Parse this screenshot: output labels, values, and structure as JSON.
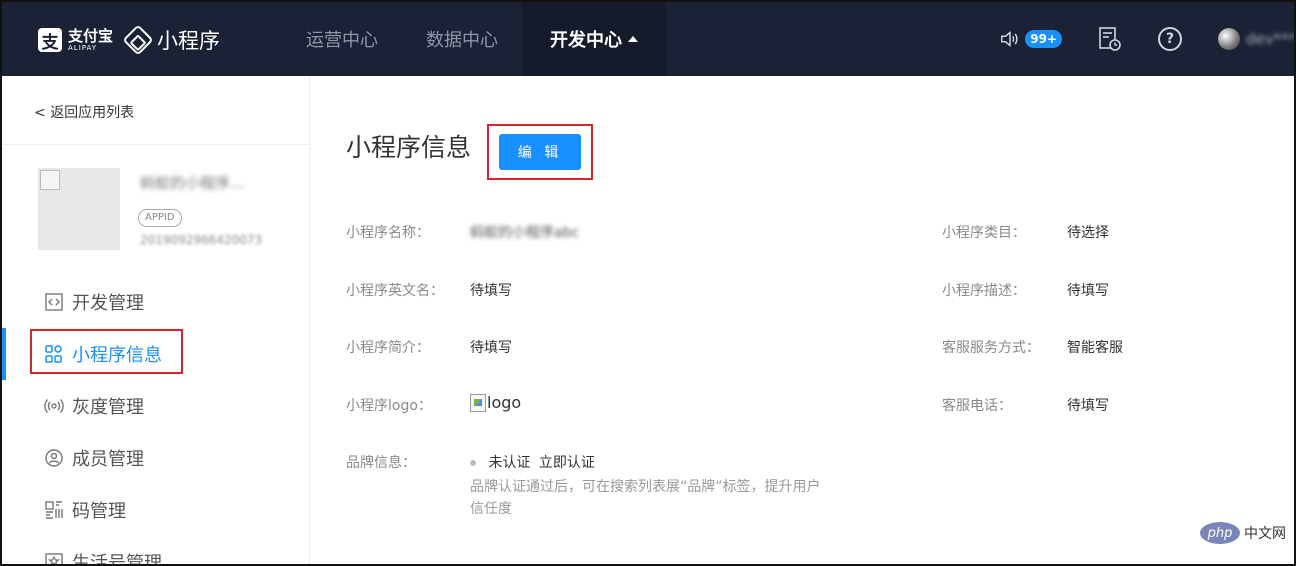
{
  "header": {
    "alipay_cn": "支付宝",
    "alipay_en": "ALIPAY",
    "product": "小程序",
    "nav": [
      {
        "label": "运营中心"
      },
      {
        "label": "数据中心"
      },
      {
        "label": "开发中心"
      }
    ],
    "notification_badge": "99+",
    "username": "dev***",
    "help_symbol": "?"
  },
  "sidebar": {
    "back": "返回应用列表",
    "app_name": "蚂蚁的小程序...",
    "appid_tag": "APPID",
    "appid": "2019092966420073",
    "items": [
      {
        "label": "开发管理",
        "icon": "code-icon"
      },
      {
        "label": "小程序信息",
        "icon": "grid-icon",
        "active": true
      },
      {
        "label": "灰度管理",
        "icon": "broadcast-icon"
      },
      {
        "label": "成员管理",
        "icon": "user-icon"
      },
      {
        "label": "码管理",
        "icon": "qrcode-icon"
      },
      {
        "label": "生活号管理",
        "icon": "life-icon"
      }
    ]
  },
  "main": {
    "title": "小程序信息",
    "edit_button": "编 辑",
    "fields": {
      "name_label": "小程序名称：",
      "name_value": "蚂蚁的小程序abc",
      "category_label": "小程序类目：",
      "category_value": "待选择",
      "en_name_label": "小程序英文名：",
      "en_name_value": "待填写",
      "desc_label": "小程序描述：",
      "desc_value": "待填写",
      "intro_label": "小程序简介：",
      "intro_value": "待填写",
      "service_label": "客服服务方式：",
      "service_value": "智能客服",
      "logo_label": "小程序logo：",
      "logo_value": "logo",
      "phone_label": "客服电话：",
      "phone_value": "待填写",
      "brand_label": "品牌信息：",
      "brand_status": "未认证",
      "brand_action": "立即认证",
      "brand_hint": "品牌认证通过后，可在搜索列表展“品牌”标签，提升用户信任度"
    }
  },
  "watermark": {
    "badge": "php",
    "text": "中文网"
  },
  "colors": {
    "header_bg": "#1b2235",
    "accent": "#1890ff",
    "highlight": "#d9232d"
  }
}
